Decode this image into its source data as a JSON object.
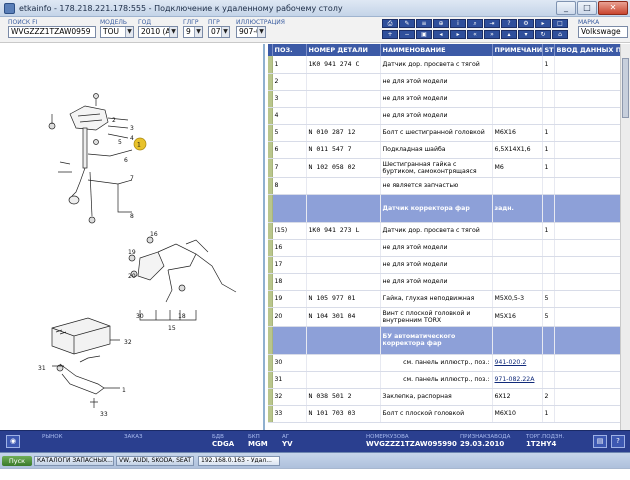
{
  "window": {
    "title": "etkainfo - 178.218.221.178:555 - Подключение к удаленному рабочему столу",
    "buttons": [
      "_",
      "□",
      "✕"
    ]
  },
  "filters": {
    "search_label": "ПОИСК FI",
    "search_value": "WVGZZZ1TZAW0959",
    "model_label": "МОДЕЛЬ",
    "model_value": "TOU",
    "year_label": "ГОД",
    "year_value": "2010 (A)",
    "main_group_label": "ГЛГР",
    "main_group_value": "9",
    "sub_group_label": "ПГР",
    "sub_group_value": "07",
    "illustration_label": "ИЛЛЮСТРАЦИЯ",
    "illustration_value": "907-030",
    "brand_label": "МАРКА",
    "brand_value": "Volkswage"
  },
  "table": {
    "headers": [
      "ПОЗ.",
      "НОМЕР ДЕТАЛИ",
      "НАИМЕНОВАНИЕ",
      "ПРИМЕЧАНИЕ",
      "ST",
      "ВВОД ДАННЫХ ПО"
    ],
    "rows": [
      {
        "pos": "1",
        "part": "1K0 941 274 C",
        "name": "Датчик дор. просвета с тягой",
        "note": "",
        "st": "1"
      },
      {
        "pos": "2",
        "part": "",
        "name": "не для этой модели",
        "note": "",
        "st": ""
      },
      {
        "pos": "3",
        "part": "",
        "name": "не для этой модели",
        "note": "",
        "st": ""
      },
      {
        "pos": "4",
        "part": "",
        "name": "не для этой модели",
        "note": "",
        "st": ""
      },
      {
        "pos": "5",
        "part": "N 010 287 12",
        "name": "Болт с шестигранной головкой",
        "note": "M6X16",
        "st": "1"
      },
      {
        "pos": "6",
        "part": "N 011 547 7",
        "name": "Подкладная шайба",
        "note": "6,5X14X1,6",
        "st": "1"
      },
      {
        "pos": "7",
        "part": "N 102 058 02",
        "name": "Шестигранная гайка с буртиком, самоконтрящаяся",
        "note": "M6",
        "st": "1"
      },
      {
        "pos": "8",
        "part": "",
        "name": "не является запчастью",
        "note": "",
        "st": ""
      }
    ],
    "section1": {
      "name": "Датчик корректора фар",
      "note": "задн."
    },
    "rows2": [
      {
        "pos": "(15)",
        "part": "1K0 941 273 L",
        "name": "Датчик дор. просвета с тягой",
        "note": "",
        "st": "1"
      },
      {
        "pos": "16",
        "part": "",
        "name": "не для этой модели",
        "note": "",
        "st": ""
      },
      {
        "pos": "17",
        "part": "",
        "name": "не для этой модели",
        "note": "",
        "st": ""
      },
      {
        "pos": "18",
        "part": "",
        "name": "не для этой модели",
        "note": "",
        "st": ""
      },
      {
        "pos": "19",
        "part": "N 105 977 01",
        "name": "Гайка, глухая неподвижная",
        "note": "M5X0,5-3",
        "st": "5"
      },
      {
        "pos": "20",
        "part": "N 104 301 04",
        "name": "Винт с плоской головкой и внутренним TORX",
        "note": "M5X16",
        "st": "5"
      }
    ],
    "section2": {
      "name": "БУ автоматического корректора фар",
      "note": ""
    },
    "rows3": [
      {
        "pos": "30",
        "part": "",
        "name": "см. панель иллюстр., поз.:",
        "note": "941-020.2",
        "st": ""
      },
      {
        "pos": "31",
        "part": "",
        "name": "см. панель иллюстр., поз.:",
        "note": "971-082.22A",
        "st": ""
      },
      {
        "pos": "32",
        "part": "N 038 501 2",
        "name": "Заклепка, распорная",
        "note": "6X12",
        "st": "2"
      },
      {
        "pos": "33",
        "part": "N 101 703 03",
        "name": "Болт с плоской головкой",
        "note": "M6X10",
        "st": "1"
      }
    ]
  },
  "statusbar": {
    "market_label": "РЫНОК",
    "order_label": "ЗАКАЗ",
    "engine_label": "БДВ",
    "engine_value": "CDGA",
    "gearbox_label": "БКП",
    "gearbox_value": "MGM",
    "ag_label": "АГ",
    "ag_value": "YV",
    "vin_label": "НОМЕРКУЗОВА",
    "vin_value": "WVGZZZ1TZAW095990",
    "date_label": "ПРИЗНАКЗАВОДА",
    "date_value": "29.03.2010",
    "paint_label": "ТОРГ.ПОДЗН.",
    "paint_value": "1T2HY4"
  },
  "taskbar": {
    "start": "Пуск",
    "tasks": [
      "КАТАЛОГИ ЗАПАСНЫХ...",
      "VW, AUDI, SKODA, SEAT",
      "192.168.0.163 - Удал..."
    ]
  },
  "diagram": {
    "callouts": [
      "2",
      "3",
      "4",
      "1",
      "5",
      "6",
      "7",
      "8",
      "19",
      "20",
      "16",
      "15",
      "17",
      "18",
      "30",
      "32",
      "33",
      "31",
      "1"
    ]
  }
}
